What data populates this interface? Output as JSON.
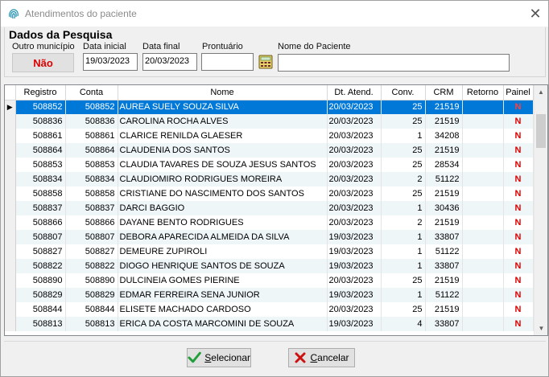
{
  "window": {
    "title": "Atendimentos do paciente",
    "close_glyph": "✕"
  },
  "search": {
    "group_title": "Dados da Pesquisa",
    "outro_municipio_label": "Outro município",
    "outro_municipio_value": "Não",
    "data_inicial_label": "Data inicial",
    "data_inicial_value": "19/03/2023",
    "data_final_label": "Data final",
    "data_final_value": "20/03/2023",
    "prontuario_label": "Prontuário",
    "prontuario_value": "",
    "nome_paciente_label": "Nome do Paciente",
    "nome_paciente_value": ""
  },
  "grid": {
    "columns": [
      "Registro",
      "Conta",
      "Nome",
      "Dt. Atend.",
      "Conv.",
      "CRM",
      "Retorno",
      "Painel"
    ],
    "rows": [
      [
        "508852",
        "508852",
        "AUREA SUELY SOUZA SILVA",
        "20/03/2023",
        "25",
        "21519",
        "",
        "N"
      ],
      [
        "508836",
        "508836",
        "CAROLINA ROCHA ALVES",
        "20/03/2023",
        "25",
        "21519",
        "",
        "N"
      ],
      [
        "508861",
        "508861",
        "CLARICE RENILDA GLAESER",
        "20/03/2023",
        "1",
        "34208",
        "",
        "N"
      ],
      [
        "508864",
        "508864",
        "CLAUDENIA DOS SANTOS",
        "20/03/2023",
        "25",
        "21519",
        "",
        "N"
      ],
      [
        "508853",
        "508853",
        "CLAUDIA TAVARES DE SOUZA JESUS SANTOS",
        "20/03/2023",
        "25",
        "28534",
        "",
        "N"
      ],
      [
        "508834",
        "508834",
        "CLAUDIOMIRO RODRIGUES MOREIRA",
        "20/03/2023",
        "2",
        "51122",
        "",
        "N"
      ],
      [
        "508858",
        "508858",
        "CRISTIANE DO NASCIMENTO DOS SANTOS",
        "20/03/2023",
        "25",
        "21519",
        "",
        "N"
      ],
      [
        "508837",
        "508837",
        "DARCI BAGGIO",
        "20/03/2023",
        "1",
        "30436",
        "",
        "N"
      ],
      [
        "508866",
        "508866",
        "DAYANE BENTO RODRIGUES",
        "20/03/2023",
        "2",
        "21519",
        "",
        "N"
      ],
      [
        "508807",
        "508807",
        "DEBORA APARECIDA ALMEIDA DA SILVA",
        "19/03/2023",
        "1",
        "33807",
        "",
        "N"
      ],
      [
        "508827",
        "508827",
        "DEMEURE ZUPIROLI",
        "19/03/2023",
        "1",
        "51122",
        "",
        "N"
      ],
      [
        "508822",
        "508822",
        "DIOGO HENRIQUE SANTOS DE SOUZA",
        "19/03/2023",
        "1",
        "33807",
        "",
        "N"
      ],
      [
        "508890",
        "508890",
        "DULCINEIA GOMES PIERINE",
        "20/03/2023",
        "25",
        "21519",
        "",
        "N"
      ],
      [
        "508829",
        "508829",
        "EDMAR FERREIRA SENA JUNIOR",
        "19/03/2023",
        "1",
        "51122",
        "",
        "N"
      ],
      [
        "508844",
        "508844",
        "ELISETE MACHADO CARDOSO",
        "20/03/2023",
        "25",
        "21519",
        "",
        "N"
      ],
      [
        "508813",
        "508813",
        "ERICA DA COSTA MARCOMINI DE SOUZA",
        "19/03/2023",
        "4",
        "33807",
        "",
        "N"
      ]
    ],
    "selected_row": 0,
    "row_indicator": "▶"
  },
  "buttons": {
    "selecionar_accel": "S",
    "selecionar_rest": "elecionar",
    "cancelar_accel": "C",
    "cancelar_rest": "ancelar"
  },
  "colors": {
    "selection": "#0078d7",
    "alt_row": "#eef6f8",
    "painel_red": "#e00000",
    "check_green": "#1f9e3a",
    "cancel_red": "#cc1111"
  },
  "icons": {
    "app": "fingerprint-icon",
    "lookup": "calculator-icon",
    "select": "check-icon",
    "cancel": "x-icon"
  }
}
